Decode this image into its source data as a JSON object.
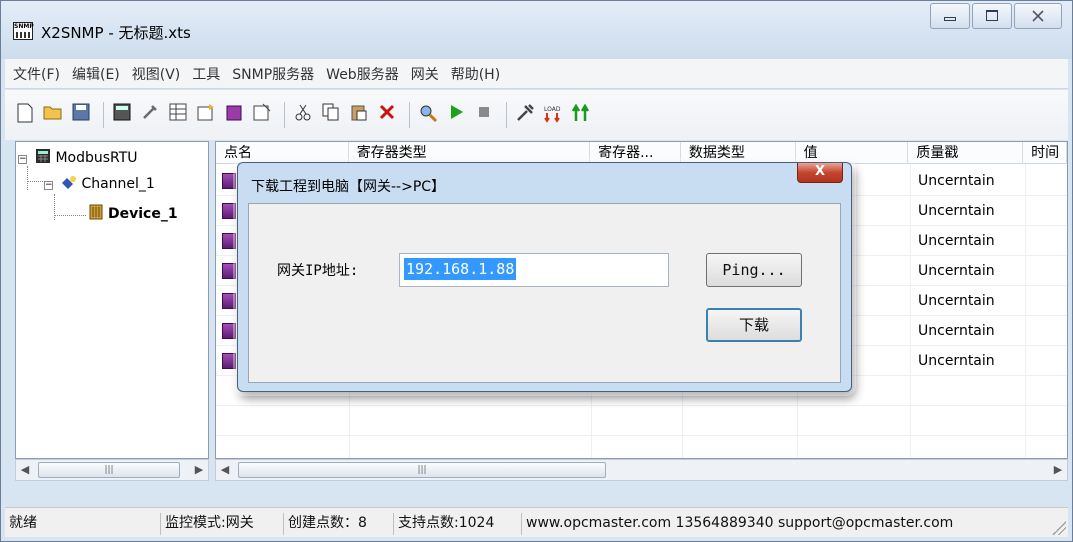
{
  "window": {
    "title": "X2SNMP - 无标题.xts",
    "icon_text": "SNMP"
  },
  "menu": [
    "文件(F)",
    "编辑(E)",
    "视图(V)",
    "工具",
    "SNMP服务器",
    "Web服务器",
    "网关",
    "帮助(H)"
  ],
  "toolbar": [
    "new-icon",
    "open-icon",
    "save-icon",
    "calculator-icon",
    "tool-icon",
    "table-icon",
    "add-icon",
    "device-icon",
    "properties-icon",
    "cut-icon",
    "copy-icon",
    "paste-icon",
    "delete-icon",
    "search-icon",
    "run-icon",
    "stop-icon",
    "settings-icon",
    "load-icon",
    "upload-icon"
  ],
  "tree": {
    "root": "ModbusRTU",
    "channel": "Channel_1",
    "device": "Device_1"
  },
  "grid": {
    "columns": [
      "点名",
      "寄存器类型",
      "寄存器...",
      "数据类型",
      "值",
      "质量戳",
      "时间"
    ],
    "rows": [
      {
        "quality": "Uncerntain"
      },
      {
        "quality": "Uncerntain"
      },
      {
        "quality": "Uncerntain"
      },
      {
        "quality": "Uncerntain"
      },
      {
        "quality": "Uncerntain"
      },
      {
        "quality": "Uncerntain"
      },
      {
        "quality": "Uncerntain"
      }
    ]
  },
  "status": {
    "ready": "就绪",
    "mode": "监控模式:网关",
    "points_created": "创建点数：8",
    "points_supported": "支持点数:1024",
    "contact": "www.opcmaster.com 13564889340 support@opcmaster.com"
  },
  "dialog": {
    "title": "下载工程到电脑【网关-->PC】",
    "ip_label": "网关IP地址:",
    "ip_value": "192.168.1.88",
    "ping_button": "Ping...",
    "download_button": "下载",
    "close_glyph": "X"
  },
  "colors": {
    "selection": "#3399ff",
    "close_button": "#c54630",
    "dialog_frame": "#c8dcf2"
  }
}
